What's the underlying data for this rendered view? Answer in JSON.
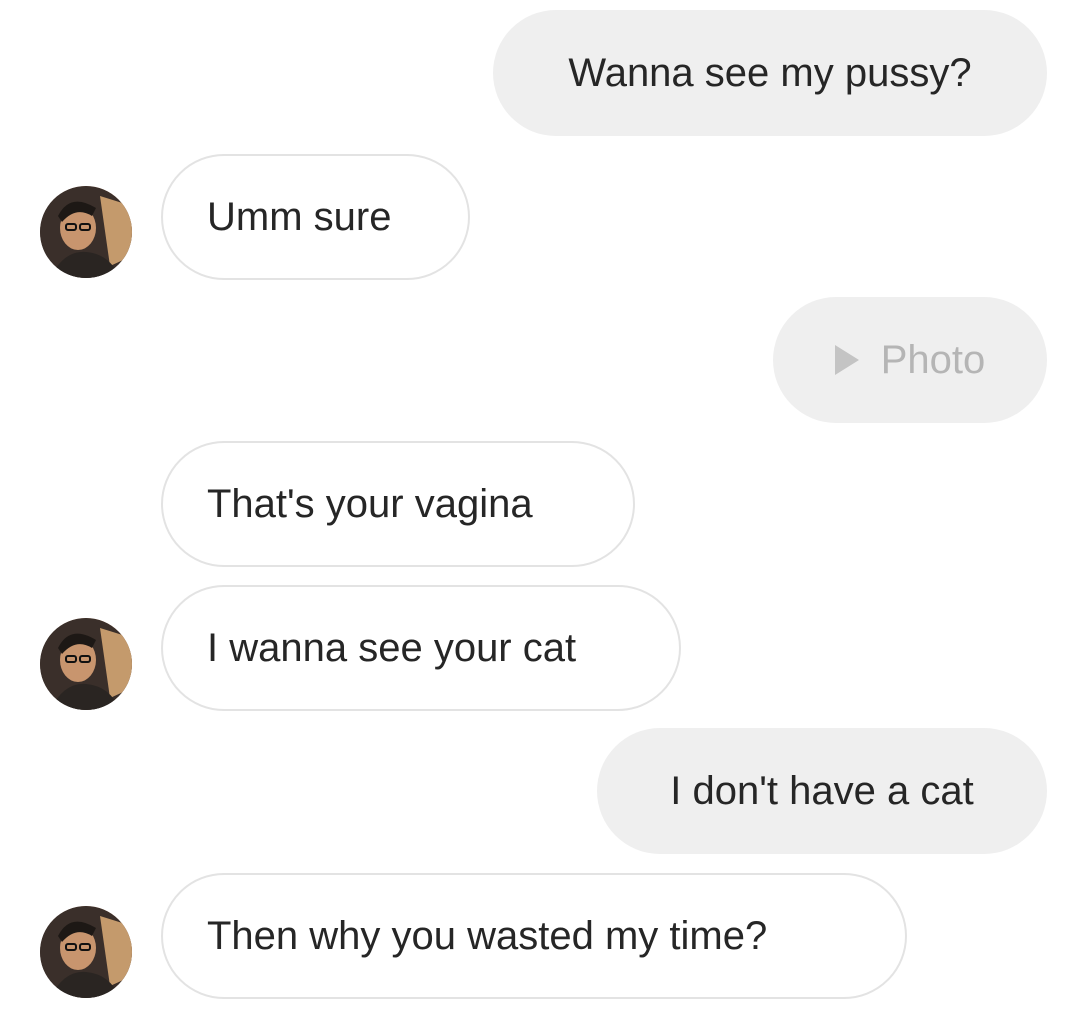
{
  "messages": [
    {
      "side": "sent",
      "text": "Wanna see my pussy?"
    },
    {
      "side": "received",
      "text": "Umm sure"
    },
    {
      "side": "sent",
      "type": "photo",
      "text": "Photo",
      "icon": "play-icon"
    },
    {
      "side": "received",
      "text": "That's your vagina"
    },
    {
      "side": "received",
      "text": "I wanna see your cat"
    },
    {
      "side": "sent",
      "text": "I don't have a cat"
    },
    {
      "side": "received",
      "text": "Then why you wasted my time?"
    }
  ],
  "colors": {
    "sent_bubble": "#efefef",
    "received_border": "#e3e3e3",
    "text": "#262626",
    "photo_text": "#b5b5b5"
  }
}
